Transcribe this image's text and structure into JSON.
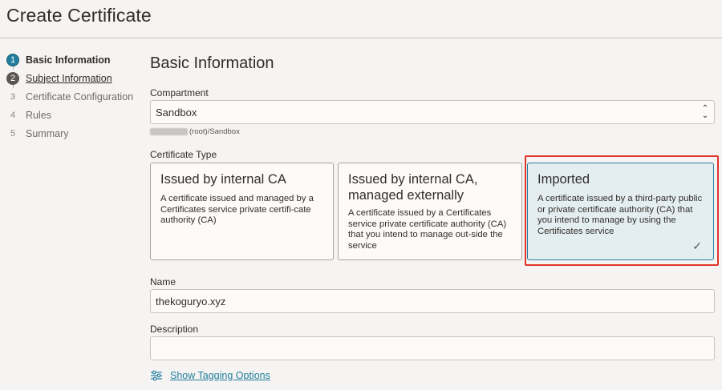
{
  "page": {
    "title": "Create Certificate"
  },
  "steps": [
    {
      "num": "1",
      "label": "Basic Information",
      "state": "active"
    },
    {
      "num": "2",
      "label": "Subject Information",
      "state": "visited"
    },
    {
      "num": "3",
      "label": "Certificate Configuration",
      "state": "pending"
    },
    {
      "num": "4",
      "label": "Rules",
      "state": "pending"
    },
    {
      "num": "5",
      "label": "Summary",
      "state": "pending"
    }
  ],
  "section": {
    "title": "Basic Information"
  },
  "compartment": {
    "label": "Compartment",
    "value": "Sandbox",
    "path": "(root)/Sandbox"
  },
  "cert_type": {
    "label": "Certificate Type",
    "options": [
      {
        "title": "Issued by internal CA",
        "desc": "A certificate issued and managed by a Certificates service private certifi-cate authority (CA)",
        "selected": false
      },
      {
        "title": "Issued by internal CA, managed externally",
        "desc": "A certificate issued by a Certificates service private certificate authority (CA) that you intend to manage out-side the service",
        "selected": false
      },
      {
        "title": "Imported",
        "desc": "A certificate issued by a third-party public or private certificate authority (CA) that you intend to manage by using the Certificates service",
        "selected": true
      }
    ]
  },
  "name": {
    "label": "Name",
    "value": "thekoguryo.xyz"
  },
  "description": {
    "label": "Description",
    "value": ""
  },
  "tagging": {
    "label": "Show Tagging Options"
  },
  "colors": {
    "accent": "#227e9e",
    "highlight": "#e0352b"
  },
  "icons": {
    "checkmark": "check-icon",
    "tags": "sliders-icon",
    "select": "chevron-updown-icon"
  }
}
